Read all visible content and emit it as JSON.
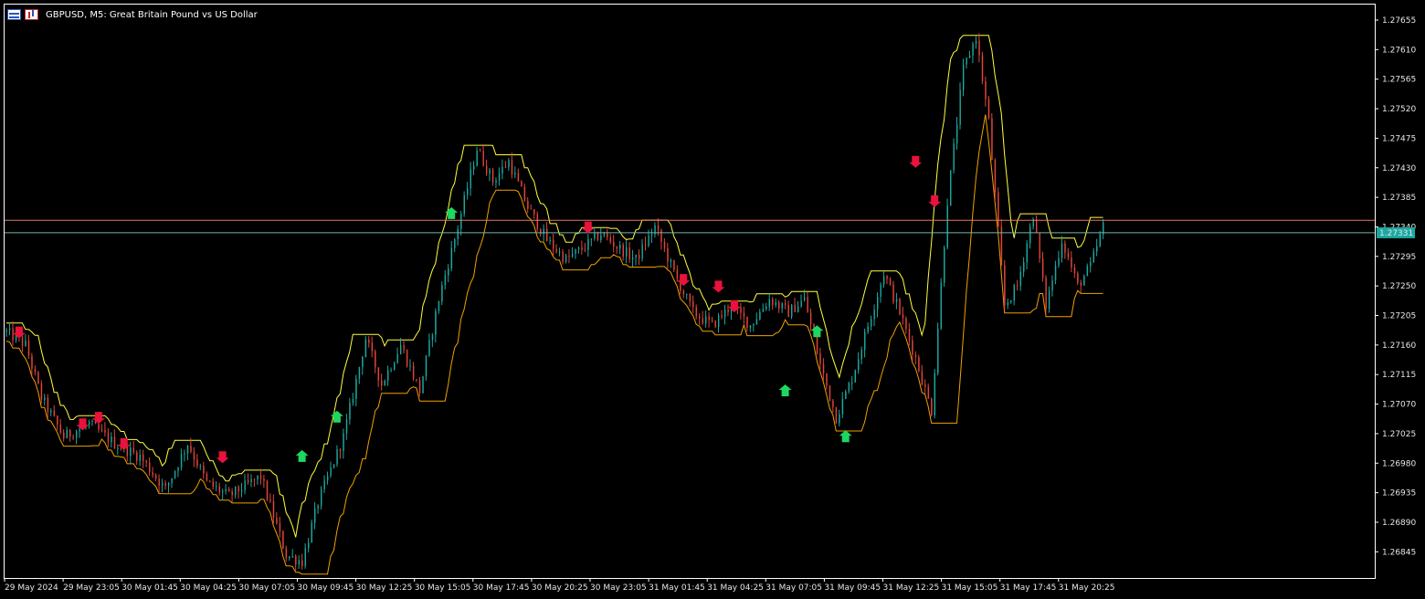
{
  "window": {
    "title": "GBPUSD, M5:  Great Britain Pound vs US Dollar",
    "icons": [
      "table-icon",
      "chart-bars-icon"
    ]
  },
  "colors": {
    "background": "#000000",
    "bull": "#1ba8a0",
    "bear": "#e0453a",
    "upper_band": "#ffff3c",
    "lower_band": "#f0a000",
    "arrow_up": "#1ed760",
    "arrow_down": "#e8123c",
    "price_line": "#e07a5f",
    "price_line_2": "#6fb6b1",
    "current_price_bg": "#1ba8a0"
  },
  "chart_data": {
    "type": "candlestick",
    "symbol": "GBPUSD",
    "timeframe": "M5",
    "current_price": "1.27331",
    "price_line_values": [
      1.2735,
      1.27331
    ],
    "ylim": [
      1.26815,
      1.27685
    ],
    "y_ticks": [
      "1.27655",
      "1.27610",
      "1.27565",
      "1.27520",
      "1.27475",
      "1.27430",
      "1.27385",
      "1.27340",
      "1.27295",
      "1.27250",
      "1.27205",
      "1.27160",
      "1.27115",
      "1.27070",
      "1.27025",
      "1.26980",
      "1.26935",
      "1.26890",
      "1.26845"
    ],
    "x_labels": [
      "29 May 2024",
      "29 May 23:05",
      "30 May 01:45",
      "30 May 04:25",
      "30 May 07:05",
      "30 May 09:45",
      "30 May 12:25",
      "30 May 15:05",
      "30 May 17:45",
      "30 May 20:25",
      "30 May 23:05",
      "31 May 01:45",
      "31 May 04:25",
      "31 May 07:05",
      "31 May 09:45",
      "31 May 12:25",
      "31 May 15:05",
      "31 May 17:45",
      "31 May 20:25"
    ],
    "price_path": [
      [
        0,
        1.2718
      ],
      [
        6,
        1.2716
      ],
      [
        11,
        1.2708
      ],
      [
        18,
        1.2702
      ],
      [
        26,
        1.2704
      ],
      [
        34,
        1.2701
      ],
      [
        42,
        1.2699
      ],
      [
        50,
        1.2694
      ],
      [
        57,
        1.2701
      ],
      [
        63,
        1.2695
      ],
      [
        70,
        1.2693
      ],
      [
        80,
        1.2696
      ],
      [
        88,
        1.2684
      ],
      [
        93,
        1.2683
      ],
      [
        98,
        1.2692
      ],
      [
        106,
        1.2702
      ],
      [
        113,
        1.2717
      ],
      [
        118,
        1.271
      ],
      [
        124,
        1.2716
      ],
      [
        130,
        1.2709
      ],
      [
        136,
        1.2723
      ],
      [
        142,
        1.2734
      ],
      [
        148,
        1.2746
      ],
      [
        153,
        1.2741
      ],
      [
        158,
        1.2744
      ],
      [
        164,
        1.2737
      ],
      [
        170,
        1.2732
      ],
      [
        176,
        1.2729
      ],
      [
        182,
        1.2731
      ],
      [
        187,
        1.2733
      ],
      [
        192,
        1.2731
      ],
      [
        198,
        1.2729
      ],
      [
        204,
        1.2734
      ],
      [
        210,
        1.2727
      ],
      [
        216,
        1.2721
      ],
      [
        222,
        1.2719
      ],
      [
        228,
        1.2722
      ],
      [
        234,
        1.2719
      ],
      [
        240,
        1.2723
      ],
      [
        246,
        1.2721
      ],
      [
        251,
        1.2723
      ],
      [
        256,
        1.2713
      ],
      [
        261,
        1.2705
      ],
      [
        266,
        1.2711
      ],
      [
        271,
        1.2719
      ],
      [
        276,
        1.2727
      ],
      [
        281,
        1.2721
      ],
      [
        286,
        1.2714
      ],
      [
        291,
        1.2706
      ],
      [
        296,
        1.2738
      ],
      [
        301,
        1.2758
      ],
      [
        305,
        1.2763
      ],
      [
        309,
        1.275
      ],
      [
        314,
        1.2722
      ],
      [
        318,
        1.2725
      ],
      [
        323,
        1.2736
      ],
      [
        327,
        1.2722
      ],
      [
        332,
        1.2732
      ],
      [
        337,
        1.2725
      ],
      [
        341,
        1.2728
      ],
      [
        345,
        1.2734
      ]
    ],
    "arrows": [
      {
        "type": "down",
        "bar": 4,
        "price": 1.2717
      },
      {
        "type": "down",
        "bar": 24,
        "price": 1.2703
      },
      {
        "type": "down",
        "bar": 29,
        "price": 1.2704
      },
      {
        "type": "down",
        "bar": 37,
        "price": 1.27
      },
      {
        "type": "down",
        "bar": 68,
        "price": 1.2698
      },
      {
        "type": "up",
        "bar": 93,
        "price": 1.27
      },
      {
        "type": "up",
        "bar": 104,
        "price": 1.2706
      },
      {
        "type": "up",
        "bar": 140,
        "price": 1.2737
      },
      {
        "type": "down",
        "bar": 183,
        "price": 1.2733
      },
      {
        "type": "down",
        "bar": 213,
        "price": 1.2725
      },
      {
        "type": "down",
        "bar": 224,
        "price": 1.2724
      },
      {
        "type": "down",
        "bar": 229,
        "price": 1.2721
      },
      {
        "type": "up",
        "bar": 245,
        "price": 1.271
      },
      {
        "type": "up",
        "bar": 255,
        "price": 1.2719
      },
      {
        "type": "up",
        "bar": 264,
        "price": 1.2703
      },
      {
        "type": "down",
        "bar": 286,
        "price": 1.2743
      },
      {
        "type": "down",
        "bar": 292,
        "price": 1.2737
      }
    ],
    "grid": false
  }
}
